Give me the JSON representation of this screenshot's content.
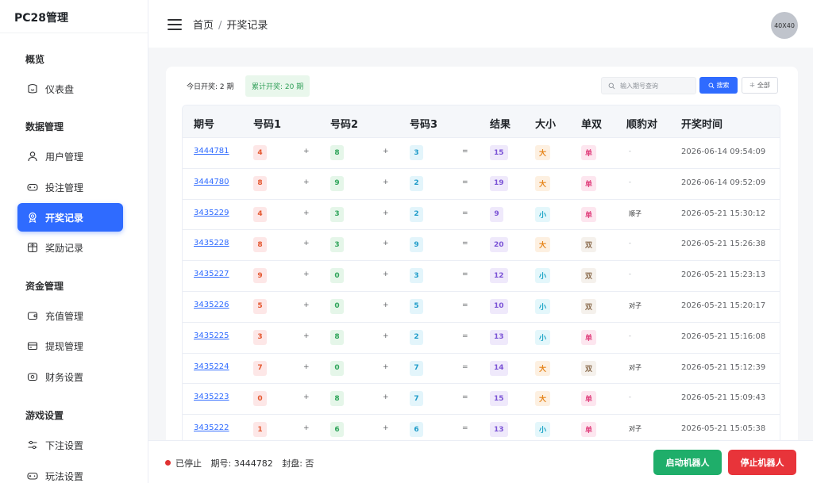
{
  "app": {
    "title": "PC28管理"
  },
  "sidebar": {
    "groups": [
      {
        "title": "概览"
      },
      {
        "title": "数据管理"
      },
      {
        "title": "资金管理"
      },
      {
        "title": "游戏设置"
      }
    ],
    "items": [
      {
        "label": "仪表盘",
        "icon": "dashboard-icon"
      },
      {
        "label": "用户管理",
        "icon": "user-icon"
      },
      {
        "label": "投注管理",
        "icon": "gamepad-icon"
      },
      {
        "label": "开奖记录",
        "icon": "award-icon",
        "active": true
      },
      {
        "label": "奖励记录",
        "icon": "gift-icon"
      },
      {
        "label": "充值管理",
        "icon": "wallet-icon"
      },
      {
        "label": "提现管理",
        "icon": "card-icon"
      },
      {
        "label": "财务设置",
        "icon": "finance-icon"
      },
      {
        "label": "下注设置",
        "icon": "sliders-icon"
      },
      {
        "label": "玩法设置",
        "icon": "gamepad-icon"
      }
    ]
  },
  "header": {
    "breadcrumb": [
      "首页",
      "开奖记录"
    ],
    "breadcrumb_sep": "/",
    "avatar_text": "40X40"
  },
  "stats": {
    "today": "今日开奖: 2 期",
    "total": "累计开奖: 20 期"
  },
  "search": {
    "placeholder": "输入期号查询",
    "search_label": "搜索",
    "all_label": "全部"
  },
  "table": {
    "headers": [
      "期号",
      "号码1",
      "号码2",
      "号码3",
      "结果",
      "大小",
      "单双",
      "顺豹对",
      "开奖时间"
    ],
    "rows": [
      {
        "issue": "3444781",
        "n1": "4",
        "n2": "8",
        "n3": "3",
        "result": "15",
        "size": "大",
        "parity": "单",
        "combo": "-",
        "time": "2026-06-14 09:54:09"
      },
      {
        "issue": "3444780",
        "n1": "8",
        "n2": "9",
        "n3": "2",
        "result": "19",
        "size": "大",
        "parity": "单",
        "combo": "-",
        "time": "2026-06-14 09:52:09"
      },
      {
        "issue": "3435229",
        "n1": "4",
        "n2": "3",
        "n3": "2",
        "result": "9",
        "size": "小",
        "parity": "单",
        "combo": "顺子",
        "time": "2026-05-21 15:30:12"
      },
      {
        "issue": "3435228",
        "n1": "8",
        "n2": "3",
        "n3": "9",
        "result": "20",
        "size": "大",
        "parity": "双",
        "combo": "-",
        "time": "2026-05-21 15:26:38"
      },
      {
        "issue": "3435227",
        "n1": "9",
        "n2": "0",
        "n3": "3",
        "result": "12",
        "size": "小",
        "parity": "双",
        "combo": "-",
        "time": "2026-05-21 15:23:13"
      },
      {
        "issue": "3435226",
        "n1": "5",
        "n2": "0",
        "n3": "5",
        "result": "10",
        "size": "小",
        "parity": "双",
        "combo": "对子",
        "time": "2026-05-21 15:20:17"
      },
      {
        "issue": "3435225",
        "n1": "3",
        "n2": "8",
        "n3": "2",
        "result": "13",
        "size": "小",
        "parity": "单",
        "combo": "-",
        "time": "2026-05-21 15:16:08"
      },
      {
        "issue": "3435224",
        "n1": "7",
        "n2": "0",
        "n3": "7",
        "result": "14",
        "size": "大",
        "parity": "双",
        "combo": "对子",
        "time": "2026-05-21 15:12:39"
      },
      {
        "issue": "3435223",
        "n1": "0",
        "n2": "8",
        "n3": "7",
        "result": "15",
        "size": "大",
        "parity": "单",
        "combo": "-",
        "time": "2026-05-21 15:09:43"
      },
      {
        "issue": "3435222",
        "n1": "1",
        "n2": "6",
        "n3": "6",
        "result": "13",
        "size": "小",
        "parity": "单",
        "combo": "对子",
        "time": "2026-05-21 15:05:38"
      }
    ],
    "plus": "+",
    "equals": "="
  },
  "footer": {
    "status": "已停止",
    "issue": "期号: 3444782",
    "sealed": "封盘: 否",
    "start_label": "启动机器人",
    "stop_label": "停止机器人"
  },
  "colors": {
    "primary": "#2f6bff",
    "success": "#1fae6a",
    "danger": "#e8343a"
  }
}
